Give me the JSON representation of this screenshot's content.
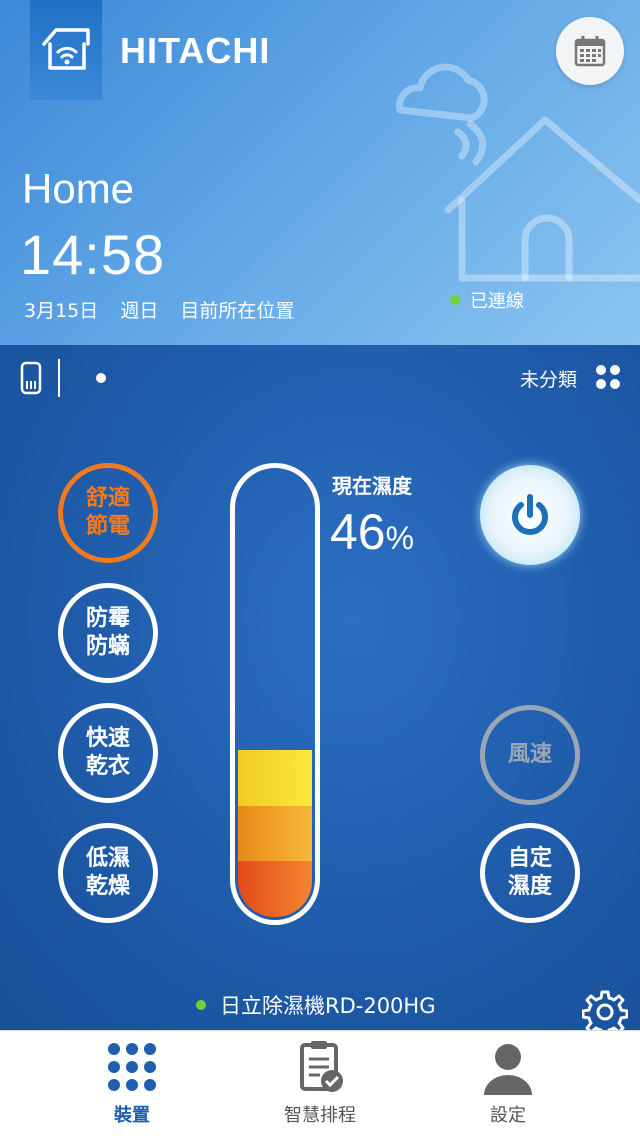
{
  "header": {
    "brand": "HITACHI",
    "home_title": "Home",
    "time": "14:58",
    "date": "3月15日",
    "weekday": "週日",
    "location": "目前所在位置",
    "connection_status": "已連線"
  },
  "panel": {
    "category_label": "未分類",
    "modes_left": [
      {
        "label": "舒適節電",
        "active": true
      },
      {
        "label": "防霉防蟎",
        "active": false
      },
      {
        "label": "快速乾衣",
        "active": false
      },
      {
        "label": "低濕乾燥",
        "active": false
      }
    ],
    "humidity_label": "現在濕度",
    "humidity_value": "46",
    "humidity_unit": "%",
    "humidity_fraction": 0.37,
    "fan_speed_label": "風速",
    "custom_humidity_label": "自定濕度",
    "device_name": "日立除濕機RD-200HG"
  },
  "colors": {
    "accent_orange": "#f07b1e",
    "panel_blue": "#1e5aa8",
    "status_green": "#6fd23a"
  },
  "nav": {
    "items": [
      {
        "label": "裝置",
        "icon": "dots-grid-icon",
        "active": true
      },
      {
        "label": "智慧排程",
        "icon": "clipboard-check-icon",
        "active": false
      },
      {
        "label": "設定",
        "icon": "user-icon",
        "active": false
      }
    ]
  }
}
